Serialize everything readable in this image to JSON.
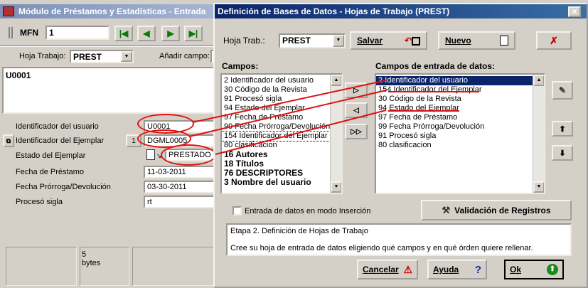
{
  "left_window": {
    "title": "Módulo de Préstamos y Estadísticas - Entrada",
    "mfn_label": "MFN",
    "mfn_value": "1",
    "hoja_label": "Hoja Trabajo:",
    "hoja_value": "PREST",
    "anadir_label": "Añadir campo:",
    "record_text": "U0001",
    "fields": [
      {
        "label": "Identificador del usuario",
        "value": "U0001"
      },
      {
        "label": "Identificador del Ejemplar",
        "value": "DGML0005"
      },
      {
        "label": "Estado del Ejemplar",
        "value": "PRESTADO"
      },
      {
        "label": "Fecha de Préstamo",
        "value": "11-03-2011"
      },
      {
        "label": "Fecha Prórroga/Devolución",
        "value": "03-30-2011"
      },
      {
        "label": "Procesó sigla",
        "value": "rt"
      }
    ],
    "ejemplar_btn": "1",
    "status_size": "5",
    "status_unit": "bytes"
  },
  "dialog": {
    "title": "Definición de Bases de Datos - Hojas de Trabajo (PREST)",
    "hoja_label": "Hoja Trab.:",
    "hoja_value": "PREST",
    "salvar": "Salvar",
    "nuevo": "Nuevo",
    "campos_label": "Campos:",
    "campos": [
      {
        "text": "2 Identificador del usuario",
        "bold": false
      },
      {
        "text": "30 Código de la Revista",
        "bold": false
      },
      {
        "text": "91 Procesó sigla",
        "bold": false
      },
      {
        "text": "94 Estado del Ejemplar",
        "bold": false
      },
      {
        "text": "97 Fecha de Préstamo",
        "bold": false
      },
      {
        "text": "99 Fecha Prórroga/Devolución",
        "bold": false
      },
      {
        "text": "154 Identificador del Ejemplar",
        "bold": false
      },
      {
        "text": "80 clasificacion",
        "bold": false
      },
      {
        "text": "16 Autores",
        "bold": true
      },
      {
        "text": "18 Títulos",
        "bold": true
      },
      {
        "text": "76 DESCRIPTORES",
        "bold": true
      },
      {
        "text": "3 Nombre del usuario",
        "bold": true
      }
    ],
    "entrada_label": "Campos de entrada de datos:",
    "entrada": [
      {
        "text": "2 Identificador del usuario",
        "selected": true
      },
      {
        "text": "154 Identificador del Ejemplar",
        "selected": false
      },
      {
        "text": "30 Código de la Revista",
        "selected": false
      },
      {
        "text": "94 Estado del Ejemplar",
        "selected": false
      },
      {
        "text": "97 Fecha de Préstamo",
        "selected": false
      },
      {
        "text": "99 Fecha Prórroga/Devolución",
        "selected": false
      },
      {
        "text": "91 Procesó sigla",
        "selected": false
      },
      {
        "text": "80 clasificacion",
        "selected": false
      }
    ],
    "insert_mode_label": "Entrada de datos en modo Inserción",
    "validacion": "Validación de Registros",
    "info_line1": "Etapa 2. Definición de Hojas de Trabajo",
    "info_line2": "Cree su hoja de entrada de datos eligiendo qué campos y en qué órden quiere rellenar.",
    "cancelar": "Cancelar",
    "ayuda": "Ayuda",
    "ok": "Ok"
  }
}
